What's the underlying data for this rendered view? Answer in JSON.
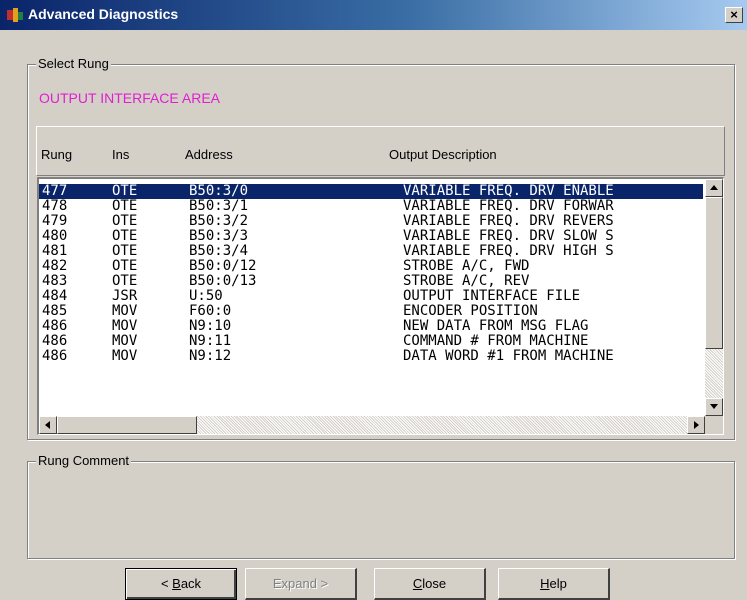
{
  "window": {
    "title": "Advanced Diagnostics",
    "close_label": "×"
  },
  "select_rung": {
    "legend": "Select Rung",
    "area_label": "OUTPUT INTERFACE AREA",
    "area_color": "#e020d0"
  },
  "table": {
    "headers": [
      "Rung",
      "Ins",
      "Address",
      "Output Description"
    ],
    "selected_index": 0,
    "rows": [
      {
        "rung": "477",
        "ins": "OTE",
        "address": "B50:3/0",
        "description": "VARIABLE FREQ. DRV ENABLE"
      },
      {
        "rung": "478",
        "ins": "OTE",
        "address": "B50:3/1",
        "description": "VARIABLE FREQ. DRV FORWAR"
      },
      {
        "rung": "479",
        "ins": "OTE",
        "address": "B50:3/2",
        "description": "VARIABLE FREQ. DRV REVERS"
      },
      {
        "rung": "480",
        "ins": "OTE",
        "address": "B50:3/3",
        "description": "VARIABLE FREQ. DRV SLOW S"
      },
      {
        "rung": "481",
        "ins": "OTE",
        "address": "B50:3/4",
        "description": "VARIABLE FREQ. DRV HIGH S"
      },
      {
        "rung": "482",
        "ins": "OTE",
        "address": "B50:0/12",
        "description": "STROBE A/C, FWD"
      },
      {
        "rung": "483",
        "ins": "OTE",
        "address": "B50:0/13",
        "description": "STROBE A/C, REV"
      },
      {
        "rung": "484",
        "ins": "JSR",
        "address": "U:50",
        "description": "OUTPUT INTERFACE FILE"
      },
      {
        "rung": "485",
        "ins": "MOV",
        "address": "F60:0",
        "description": "ENCODER POSITION"
      },
      {
        "rung": "486",
        "ins": "MOV",
        "address": "N9:10",
        "description": "NEW DATA FROM MSG FLAG"
      },
      {
        "rung": "486",
        "ins": "MOV",
        "address": "N9:11",
        "description": "COMMAND # FROM MACHINE"
      },
      {
        "rung": "486",
        "ins": "MOV",
        "address": "N9:12",
        "description": "DATA WORD #1 FROM MACHINE"
      }
    ],
    "selection_color": "#0a246a"
  },
  "rung_comment": {
    "legend": "Rung Comment",
    "text": ""
  },
  "buttons": {
    "back": {
      "label_pre": "< ",
      "label_key": "B",
      "label_post": "ack"
    },
    "expand": {
      "label": "Expand >"
    },
    "close": {
      "label_key": "C",
      "label_post": "lose"
    },
    "help": {
      "label_key": "H",
      "label_post": "elp"
    }
  }
}
